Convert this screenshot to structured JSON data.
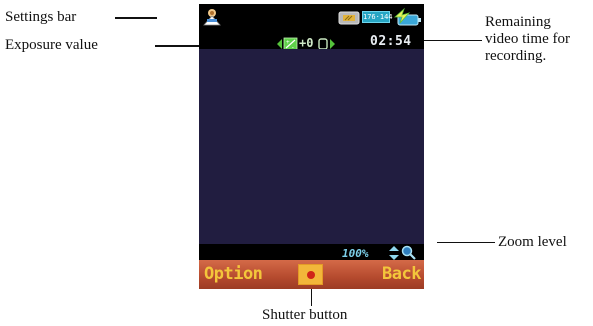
{
  "annotations": {
    "settings_bar": "Settings bar",
    "exposure_value": "Exposure value",
    "remaining_time_lines": [
      "Remaining",
      "video time for",
      "recording."
    ],
    "zoom_level": "Zoom level",
    "shutter_button": "Shutter button"
  },
  "phone": {
    "remaining_time": "02:54",
    "resolution": "176·144",
    "exposure": "+0",
    "zoom": "100%",
    "softkeys": {
      "left": "Option",
      "right": "Back"
    },
    "icons": [
      "video-settings-icon",
      "memory-card-icon",
      "resolution-icon",
      "battery-charging-icon",
      "exposure-adjust-icon",
      "zoom-adjust-icon",
      "magnifier-icon",
      "record-icon"
    ]
  },
  "colors": {
    "screen_background": "#000000",
    "viewfinder": "#211d40",
    "softkey_bar": "#b54a2e",
    "softkey_text": "#f3c63b",
    "accent_cyan": "#27a6c4"
  }
}
